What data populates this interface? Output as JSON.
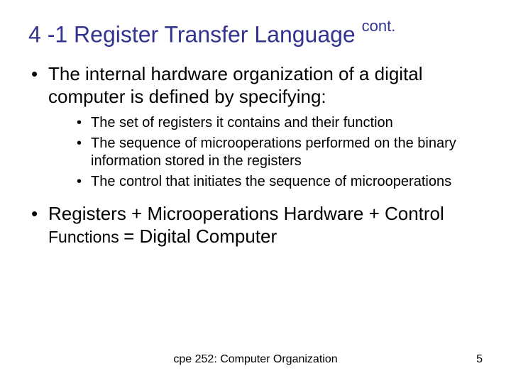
{
  "title": {
    "main": "4 -1 Register Transfer Language ",
    "sup": "cont."
  },
  "bullets": {
    "b1": "The internal hardware organization of a digital computer is defined by specifying:",
    "sub": {
      "s1": "The set of registers it contains and their function",
      "s2": "The sequence of microoperations performed on the binary information stored in the registers",
      "s3": "The control that initiates the sequence of microoperations"
    },
    "b2_a": "Registers + Microoperations Hardware + Control ",
    "b2_b": "Functions ",
    "b2_c": "= Digital Computer"
  },
  "footer": {
    "course": "cpe 252: Computer Organization",
    "page": "5"
  }
}
